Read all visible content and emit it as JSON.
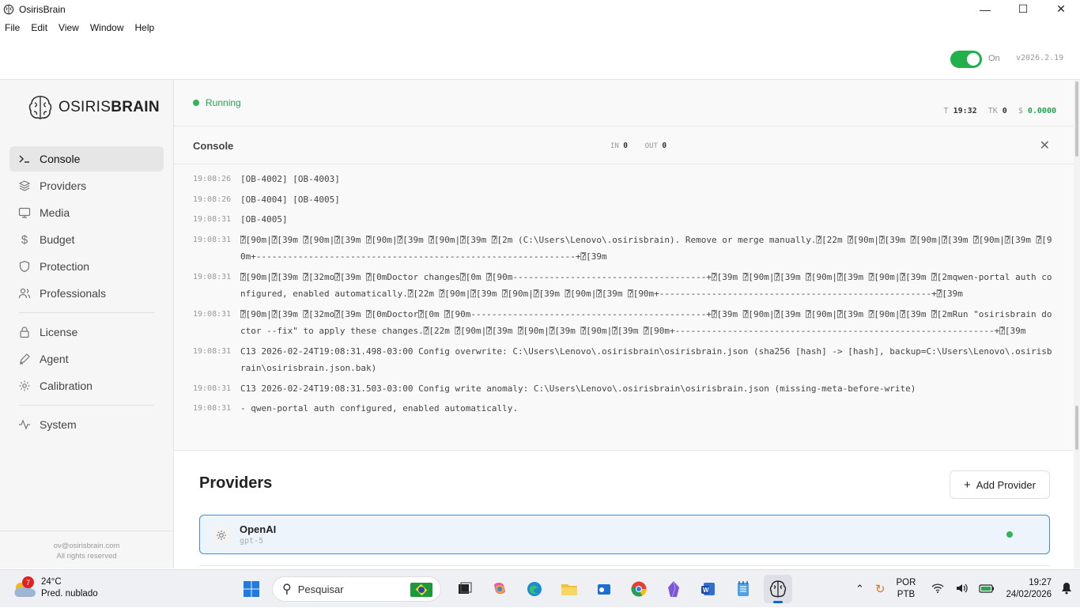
{
  "window": {
    "title": "OsirisBrain",
    "controls": [
      "—",
      "☐",
      "✕"
    ]
  },
  "menu": [
    "File",
    "Edit",
    "View",
    "Window",
    "Help"
  ],
  "topbar": {
    "toggle_label": "On",
    "toggle_on": true,
    "version": "v2026.2.19"
  },
  "sidebar": {
    "logo_light": "OSIRIS",
    "logo_bold": "BRAIN",
    "items": [
      {
        "label": "Console",
        "icon": "terminal-icon",
        "active": true
      },
      {
        "label": "Providers",
        "icon": "layers-icon"
      },
      {
        "label": "Media",
        "icon": "monitor-icon"
      },
      {
        "label": "Budget",
        "icon": "dollar-icon"
      },
      {
        "label": "Protection",
        "icon": "shield-icon"
      },
      {
        "label": "Professionals",
        "icon": "users-icon"
      }
    ],
    "items2": [
      {
        "label": "License",
        "icon": "lock-icon"
      },
      {
        "label": "Agent",
        "icon": "pen-icon"
      },
      {
        "label": "Calibration",
        "icon": "gear-icon"
      }
    ],
    "items3": [
      {
        "label": "System",
        "icon": "activity-icon"
      }
    ],
    "footer": {
      "email": "ov@osirisbrain.com",
      "rights": "All rights reserved"
    }
  },
  "status": {
    "state": "Running",
    "time_label": "T",
    "time": "19:32",
    "tokens_label": "TK",
    "tokens": "0",
    "cost_label": "$",
    "cost": "0.0000"
  },
  "console": {
    "title": "Console",
    "in_label": "IN",
    "in": "0",
    "out_label": "OUT",
    "out": "0",
    "close": "✕",
    "lines": [
      {
        "ts": "19:08:26",
        "msg": "[OB-4002] [OB-4003]"
      },
      {
        "ts": "19:08:26",
        "msg": "[OB-4004] [OB-4005]"
      },
      {
        "ts": "19:08:31",
        "msg": "[OB-4005]"
      },
      {
        "ts": "19:08:31",
        "msg": "⍰[90m|⍰[39m ⍰[90m|⍰[39m ⍰[90m|⍰[39m ⍰[90m|⍰[39m ⍰[2m (C:\\Users\\Lenovo\\.osirisbrain). Remove or merge manually.⍰[22m ⍰[90m|⍰[39m ⍰[90m|⍰[39m ⍰[90m|⍰[39m ⍰[90m+-------------------------------------------------------------+⍰[39m"
      },
      {
        "ts": "19:08:31",
        "msg": "⍰[90m|⍰[39m ⍰[32mo⍰[39m ⍰[0mDoctor changes⍰[0m ⍰[90m-------------------------------------+⍰[39m ⍰[90m|⍰[39m ⍰[90m|⍰[39m ⍰[90m|⍰[39m ⍰[2mqwen-portal auth configured, enabled automatically.⍰[22m ⍰[90m|⍰[39m ⍰[90m|⍰[39m ⍰[90m|⍰[39m ⍰[90m+----------------------------------------------------+⍰[39m"
      },
      {
        "ts": "19:08:31",
        "msg": "⍰[90m|⍰[39m ⍰[32mo⍰[39m ⍰[0mDoctor⍰[0m ⍰[90m---------------------------------------------+⍰[39m ⍰[90m|⍰[39m ⍰[90m|⍰[39m ⍰[90m|⍰[39m ⍰[2mRun \"osirisbrain doctor --fix\" to apply these changes.⍰[22m ⍰[90m|⍰[39m ⍰[90m|⍰[39m ⍰[90m|⍰[39m ⍰[90m+-------------------------------------------------------------+⍰[39m"
      },
      {
        "ts": "19:08:31",
        "msg": "C13 2026-02-24T19:08:31.498-03:00 Config overwrite: C:\\Users\\Lenovo\\.osirisbrain\\osirisbrain.json (sha256 [hash] -> [hash], backup=C:\\Users\\Lenovo\\.osirisbrain\\osirisbrain.json.bak)"
      },
      {
        "ts": "19:08:31",
        "msg": "C13 2026-02-24T19:08:31.503-03:00 Config write anomaly: C:\\Users\\Lenovo\\.osirisbrain\\osirisbrain.json (missing-meta-before-write)"
      },
      {
        "ts": "19:08:31",
        "msg": "- qwen-portal auth configured, enabled automatically."
      }
    ]
  },
  "providers": {
    "title": "Providers",
    "add_label": "Add Provider",
    "list": [
      {
        "name": "OpenAI",
        "model": "gpt-5",
        "status_color": "#2fb457"
      }
    ]
  },
  "taskbar": {
    "weather_temp": "24°C",
    "weather_desc": "Pred. nublado",
    "weather_badge": "7",
    "search_placeholder": "Pesquisar",
    "lang_line1": "POR",
    "lang_line2": "PTB",
    "time": "19:27",
    "date": "24/02/2026"
  },
  "colors": {
    "accent_green": "#22b04c",
    "selection_blue": "#3c8de0"
  }
}
